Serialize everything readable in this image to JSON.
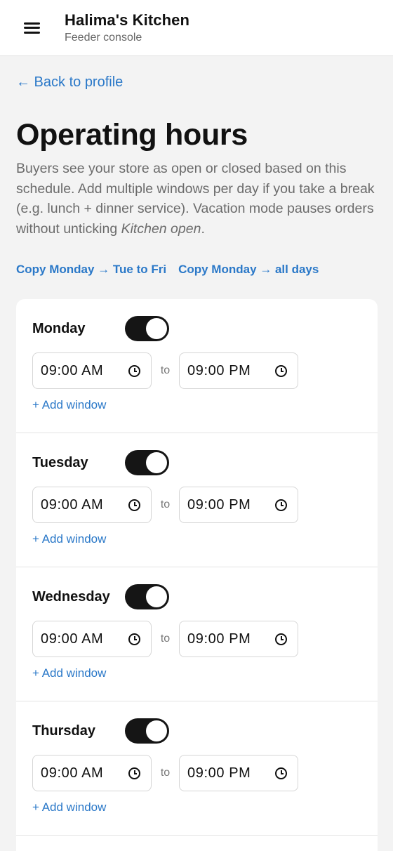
{
  "header": {
    "title": "Halima's Kitchen",
    "subtitle": "Feeder console",
    "menu_icon": "hamburger-menu-icon"
  },
  "back_link": "← Back to profile",
  "page": {
    "title": "Operating hours",
    "intro_before": "Buyers see your store as open or closed based on this schedule. Add multiple windows per day if you take a break (e.g. lunch + dinner service). Vacation mode pauses orders without unticking ",
    "intro_emphasis": "Kitchen open",
    "intro_after": "."
  },
  "copy_actions": {
    "weekdays": "Copy Monday → Tue to Fri",
    "all_days": "Copy Monday → all days"
  },
  "accent_color": "#2a78c8",
  "days": [
    {
      "name": "Monday",
      "open": true,
      "start": "09:00 AM",
      "separator": "to",
      "end": "09:00 PM",
      "add_label": "+ Add window"
    },
    {
      "name": "Tuesday",
      "open": true,
      "start": "09:00 AM",
      "separator": "to",
      "end": "09:00 PM",
      "add_label": "+ Add window"
    },
    {
      "name": "Wednesday",
      "open": true,
      "start": "09:00 AM",
      "separator": "to",
      "end": "09:00 PM",
      "add_label": "+ Add window"
    },
    {
      "name": "Thursday",
      "open": true,
      "start": "09:00 AM",
      "separator": "to",
      "end": "09:00 PM",
      "add_label": "+ Add window"
    }
  ]
}
